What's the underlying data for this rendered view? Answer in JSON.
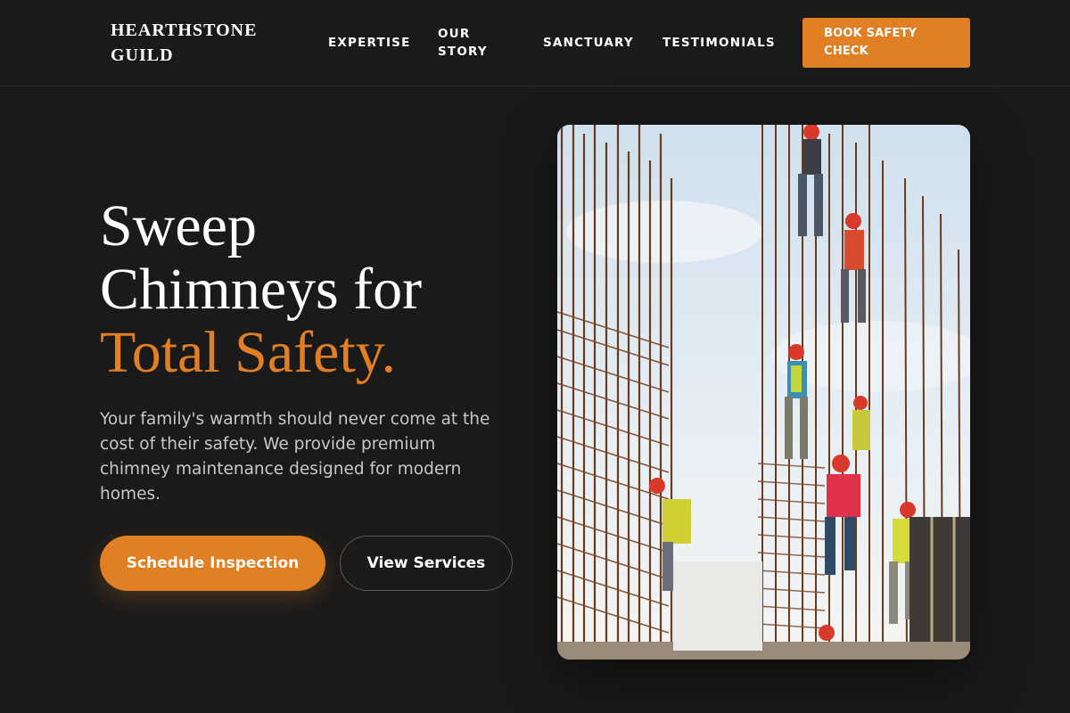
{
  "header": {
    "logo_line1": "HEARTHSTONE",
    "logo_line2": "GUILD",
    "nav": [
      {
        "label": "EXPERTISE"
      },
      {
        "label": "OUR STORY"
      },
      {
        "label": "SANCTUARY"
      },
      {
        "label": "TESTIMONIALS"
      }
    ],
    "cta_label": "BOOK SAFETY CHECK"
  },
  "hero": {
    "headline_line1": "Sweep",
    "headline_line2": "Chimneys for",
    "headline_accent": "Total Safety.",
    "lede": "Your family's warmth should never come at the cost of their safety. We provide premium chimney maintenance designed for modern homes.",
    "primary_button": "Schedule Inspection",
    "secondary_button": "View Services",
    "image_icon": "construction-workers-photo"
  },
  "colors": {
    "background": "#1a1a1a",
    "accent": "#e07f24",
    "text_muted": "#c8c8c8"
  }
}
